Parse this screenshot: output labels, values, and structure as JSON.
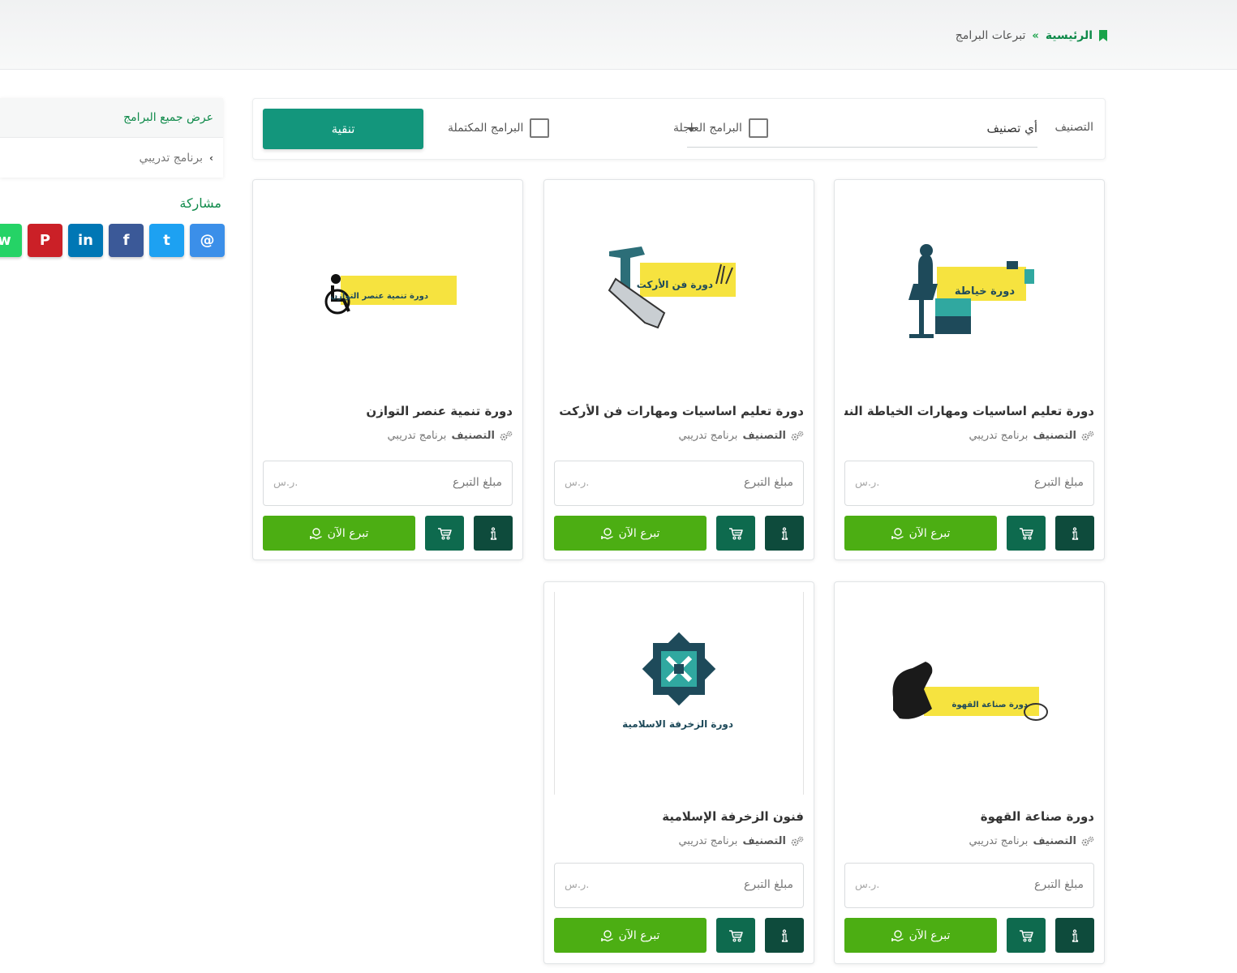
{
  "breadcrumb": {
    "home": "الرئيسية",
    "separator": "»",
    "current": "تبرعات البرامج"
  },
  "filter": {
    "label": "التصنيف",
    "select_value": "أي تصنيف",
    "urgent_label": "البرامج العاجلة",
    "completed_label": "البرامج المكتملة",
    "button_label": "تنقية"
  },
  "sidebar": {
    "items": [
      {
        "label": "عرض جميع البرامج"
      },
      {
        "label": "برنامج تدريبي"
      }
    ]
  },
  "share": {
    "title": "مشاركة",
    "buttons": [
      {
        "name": "email-share",
        "glyph": "@",
        "color": "#3b8fe9"
      },
      {
        "name": "twitter-share",
        "glyph": "t",
        "color": "#1da1f2"
      },
      {
        "name": "facebook-share",
        "glyph": "f",
        "color": "#3b5998"
      },
      {
        "name": "linkedin-share",
        "glyph": "in",
        "color": "#0077b5"
      },
      {
        "name": "pinterest-share",
        "glyph": "P",
        "color": "#cb2027"
      },
      {
        "name": "whatsapp-share",
        "glyph": "w",
        "color": "#25d366"
      }
    ]
  },
  "card_common": {
    "meta_label": "التصنيف",
    "meta_value": "برنامج تدريبي",
    "amount_placeholder": "مبلغ التبرع",
    "currency": "ر.س.",
    "donate_label": "تبرع الآن"
  },
  "cards": [
    {
      "title": "دورة تعليم اساسيات ومهارات الخياطة النس...",
      "banner": "دورة خياطة"
    },
    {
      "title": "دورة تعليم اساسيات ومهارات فن الأركت",
      "banner": "دورة فن الأركت"
    },
    {
      "title": "دورة تنمية عنصر التوازن",
      "banner": "دورة تنمية عنصر التوازن"
    },
    {
      "title": "دورة صناعة القهوة",
      "banner": "دورة صناعة القهوة"
    },
    {
      "title": "فنون الزخرفة الإسلامية",
      "banner": "دورة الزخرفة الاسلامية"
    }
  ],
  "colors": {
    "brand_green": "#0f8a4a",
    "filter_button": "#13967c",
    "donate_button": "#4cae13",
    "info_button": "#0e4b3c",
    "cart_button": "#0e6a4e",
    "banner_yellow": "#f6e33f"
  }
}
